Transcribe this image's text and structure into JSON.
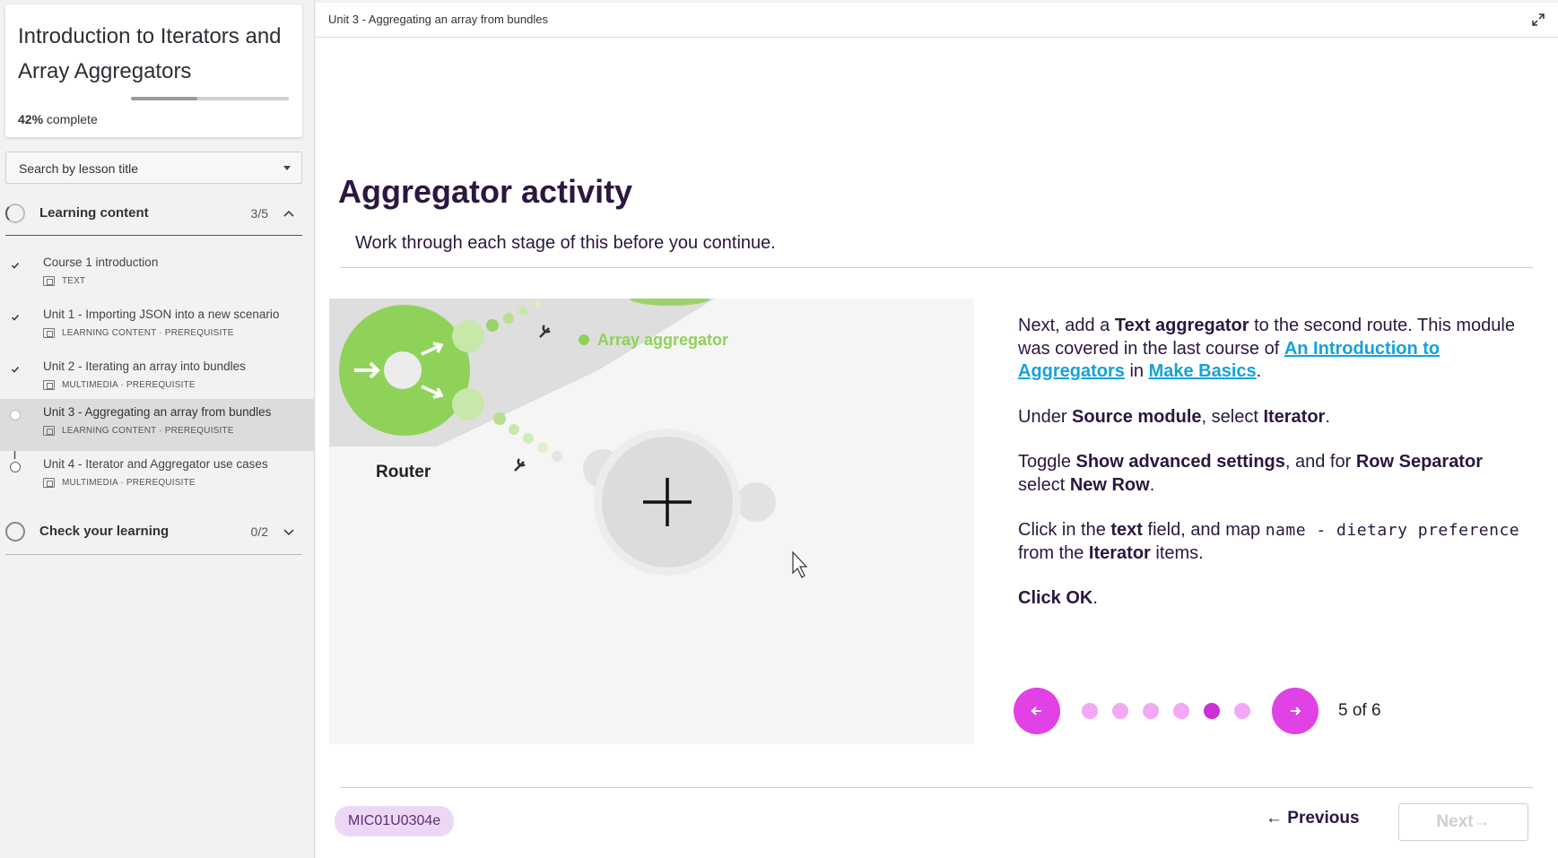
{
  "course": {
    "title": "Introduction to Iterators and Array Aggregators",
    "progress_percent": 42,
    "progress_value": "42%",
    "progress_label": "complete"
  },
  "search": {
    "label": "Search by lesson title"
  },
  "sections": [
    {
      "title": "Learning content",
      "count": "3/5",
      "expanded": true,
      "lessons": [
        {
          "title": "Course 1 introduction",
          "meta": "TEXT",
          "status": "done"
        },
        {
          "title": "Unit 1 - Importing JSON into a new scenario",
          "meta": "LEARNING CONTENT · PREREQUISITE",
          "status": "done"
        },
        {
          "title": "Unit 2 - Iterating an array into bundles",
          "meta": "MULTIMEDIA · PREREQUISITE",
          "status": "done"
        },
        {
          "title": "Unit 3 - Aggregating an array from bundles",
          "meta": "LEARNING CONTENT · PREREQUISITE",
          "status": "current"
        },
        {
          "title": "Unit 4 - Iterator and Aggregator use cases",
          "meta": "MULTIMEDIA · PREREQUISITE",
          "status": "todo"
        }
      ]
    },
    {
      "title": "Check your learning",
      "count": "0/2",
      "expanded": false
    }
  ],
  "breadcrumb": "Unit 3 - Aggregating an array from bundles",
  "activity": {
    "title": "Aggregator activity",
    "subtitle": "Work through each stage of this before you continue."
  },
  "media": {
    "router_label": "Router",
    "aggregator_label": "Array aggregator"
  },
  "instructions": {
    "p1": {
      "t1": "Next, add a ",
      "b1": "Text aggregator",
      "t2": " to the second route. This module was covered in the last course of ",
      "link1": "An Introduction to Aggregators",
      "t3": " in ",
      "link2": "Make Basics",
      "t4": "."
    },
    "p2": {
      "t1": "Under ",
      "b1": "Source module",
      "t2": ", select ",
      "b2": "Iterator",
      "t3": "."
    },
    "p3": {
      "t1": "Toggle ",
      "b1": "Show advanced settings",
      "t2": ", and for ",
      "b2": "Row Separator",
      "t3": " select ",
      "b3": "New Row",
      "t4": "."
    },
    "p4": {
      "t1": "Click in the ",
      "b1": "text",
      "t2": " field, and map ",
      "code": "name - dietary preference",
      "t3": " from the ",
      "b2": "Iterator",
      "t4": " items."
    },
    "p5": {
      "b1": "Click OK",
      "t1": "."
    }
  },
  "slider": {
    "current": 5,
    "total": 6,
    "label": "5 of 6"
  },
  "footer": {
    "code": "MIC01U0304e",
    "previous": "Previous",
    "next": "Next"
  },
  "colors": {
    "accent": "#e042e6",
    "dot": "#f3a8f5",
    "dot_active": "#cc30d6",
    "title": "#2b1740",
    "link": "#14a2d8",
    "badge_bg": "#ecd8f6"
  }
}
